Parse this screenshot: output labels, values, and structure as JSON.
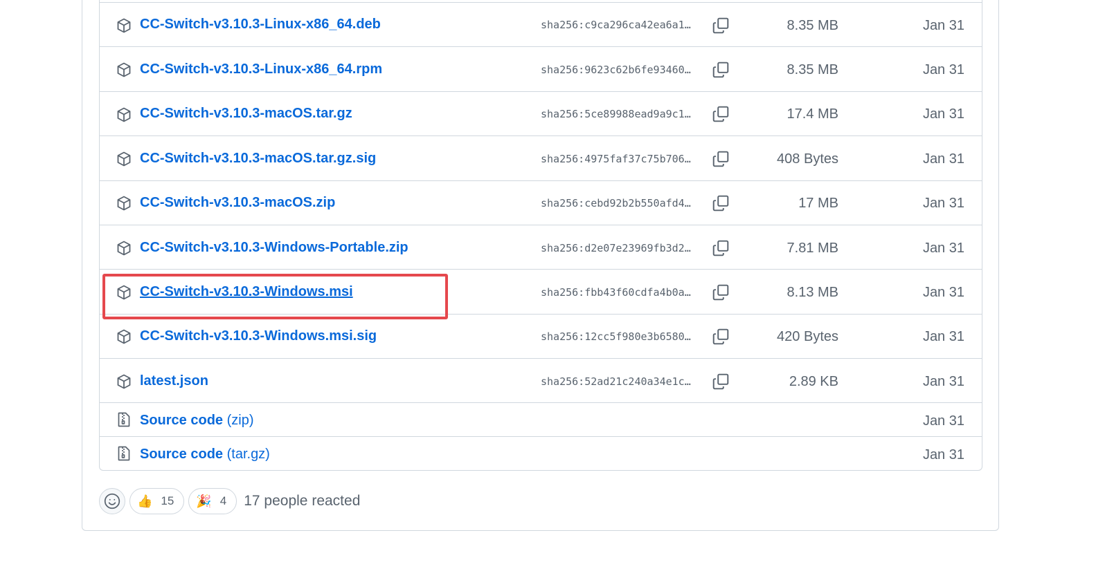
{
  "assets": [
    {
      "name": "CC-Switch-v3.10.3-Linux-x86_64.deb",
      "sha": "sha256:c9ca296ca42ea6a1…",
      "size": "8.35 MB",
      "date": "Jan 31"
    },
    {
      "name": "CC-Switch-v3.10.3-Linux-x86_64.rpm",
      "sha": "sha256:9623c62b6fe93460…",
      "size": "8.35 MB",
      "date": "Jan 31"
    },
    {
      "name": "CC-Switch-v3.10.3-macOS.tar.gz",
      "sha": "sha256:5ce89988ead9a9c1…",
      "size": "17.4 MB",
      "date": "Jan 31"
    },
    {
      "name": "CC-Switch-v3.10.3-macOS.tar.gz.sig",
      "sha": "sha256:4975faf37c75b706…",
      "size": "408 Bytes",
      "date": "Jan 31"
    },
    {
      "name": "CC-Switch-v3.10.3-macOS.zip",
      "sha": "sha256:cebd92b2b550afd4…",
      "size": "17 MB",
      "date": "Jan 31"
    },
    {
      "name": "CC-Switch-v3.10.3-Windows-Portable.zip",
      "sha": "sha256:d2e07e23969fb3d2…",
      "size": "7.81 MB",
      "date": "Jan 31"
    },
    {
      "name": "CC-Switch-v3.10.3-Windows.msi",
      "sha": "sha256:fbb43f60cdfa4b0a…",
      "size": "8.13 MB",
      "date": "Jan 31"
    },
    {
      "name": "CC-Switch-v3.10.3-Windows.msi.sig",
      "sha": "sha256:12cc5f980e3b6580…",
      "size": "420 Bytes",
      "date": "Jan 31"
    },
    {
      "name": "latest.json",
      "sha": "sha256:52ad21c240a34e1c…",
      "size": "2.89 KB",
      "date": "Jan 31"
    }
  ],
  "source": [
    {
      "label": "Source code",
      "suffix": "(zip)",
      "date": "Jan 31"
    },
    {
      "label": "Source code",
      "suffix": "(tar.gz)",
      "date": "Jan 31"
    }
  ],
  "reactions": {
    "thumbs_emoji": "👍",
    "thumbs_count": "15",
    "party_emoji": "🎉",
    "party_count": "4",
    "summary": "17 people reacted"
  },
  "colors": {
    "link": "#0969da",
    "muted": "#59636e",
    "border": "#d0d7de",
    "highlight": "#e5484d"
  },
  "icons": {
    "asset": "package-icon",
    "source": "file-zip-icon",
    "copy": "copy-icon",
    "add_reaction": "smiley-icon"
  }
}
